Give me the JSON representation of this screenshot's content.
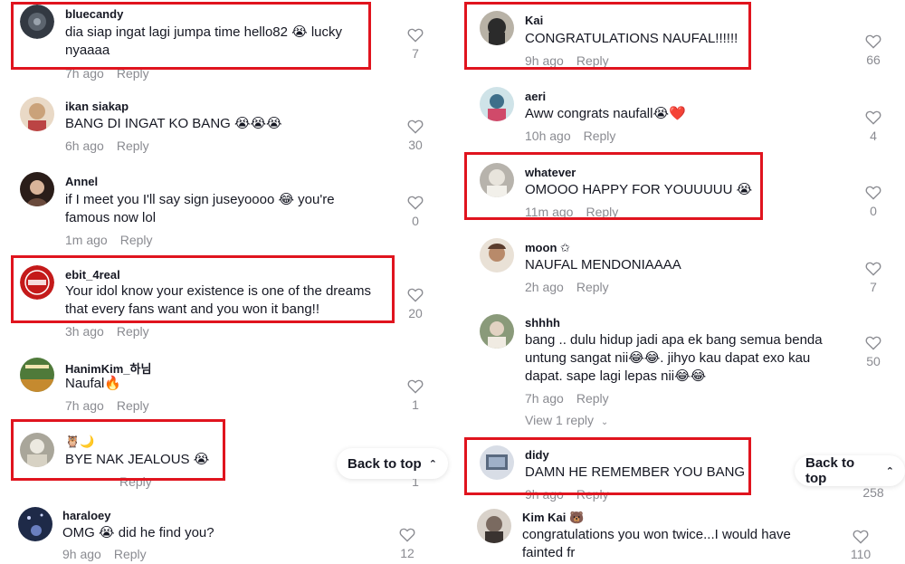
{
  "colors": {
    "highlight": "#e0141e",
    "muted": "#8a8b91",
    "text": "#161823"
  },
  "left": [
    {
      "user": "bluecandy",
      "text": "dia siap ingat lagi jumpa time hello82 😭 lucky nyaaaa",
      "time": "7h ago",
      "reply": "Reply",
      "likes": "7",
      "avatar_color": "#333942"
    },
    {
      "user": "ikan siakap",
      "text": "BANG DI INGAT KO BANG 😭😭😭",
      "time": "6h ago",
      "reply": "Reply",
      "likes": "30",
      "avatar_color": "#caa27a"
    },
    {
      "user": "Annel",
      "text": "if I meet you I'll say sign juseyoooo 😂 you're famous now lol",
      "time": "1m ago",
      "reply": "Reply",
      "likes": "0",
      "avatar_color": "#6a4a3c"
    },
    {
      "user": "ebit_4real",
      "text": "Your idol know your existence is one of the dreams that every fans want and you won it bang!!",
      "time": "3h ago",
      "reply": "Reply",
      "likes": "20",
      "avatar_color": "#c41a1a"
    },
    {
      "user": "HanimKim_하님",
      "text": "Naufal🔥",
      "time": "7h ago",
      "reply": "Reply",
      "likes": "1",
      "avatar_color": "#4f7a3a"
    },
    {
      "user": "🦉🌙",
      "text": "BYE NAK JEALOUS 😭",
      "time": "",
      "reply": "Reply",
      "likes": "1",
      "avatar_color": "#a9a69a"
    },
    {
      "user": "haraloey",
      "text": "OMG 😭 did he find you?",
      "time": "9h ago",
      "reply": "Reply",
      "likes": "12",
      "avatar_color": "#1e2a48"
    }
  ],
  "right": [
    {
      "user": "Kai",
      "text": "CONGRATULATIONS NAUFAL!!!!!!",
      "time": "9h ago",
      "reply": "Reply",
      "likes": "66",
      "avatar_color": "#2b2b2b"
    },
    {
      "user": "aeri",
      "text": "Aww congrats naufall😭❤️",
      "time": "10h ago",
      "reply": "Reply",
      "likes": "4",
      "avatar_color": "#3f6f8a"
    },
    {
      "user": "whatever",
      "text": "OMOOO HAPPY FOR YOUUUUU 😭",
      "time": "11m ago",
      "reply": "Reply",
      "likes": "0",
      "avatar_color": "#b7b3ac"
    },
    {
      "user": "moon ✩",
      "text": "NAUFAL MENDONIAAAA",
      "time": "2h ago",
      "reply": "Reply",
      "likes": "7",
      "avatar_color": "#b88a6a"
    },
    {
      "user": "shhhh",
      "text": "bang .. dulu hidup jadi apa ek bang semua benda untung sangat nii😂😂. jihyo kau dapat exo kau dapat. sape lagi lepas nii😂😂",
      "time": "7h ago",
      "reply": "Reply",
      "likes": "50",
      "avatar_color": "#8a9a7a",
      "view_replies": "View 1 reply"
    },
    {
      "user": "didy",
      "text": "DAMN HE REMEMBER YOU BANG",
      "time": "9h ago",
      "reply": "Reply",
      "likes": "258",
      "avatar_color": "#5a6a80"
    },
    {
      "user": "Kim Kai 🐻",
      "text": "congratulations you won twice...I would have fainted fr",
      "time": "",
      "reply": "",
      "likes": "110",
      "avatar_color": "#7a6a60"
    }
  ],
  "back_to_top": "Back to top",
  "back_to_top_icon": "double-chevron-up-icon"
}
